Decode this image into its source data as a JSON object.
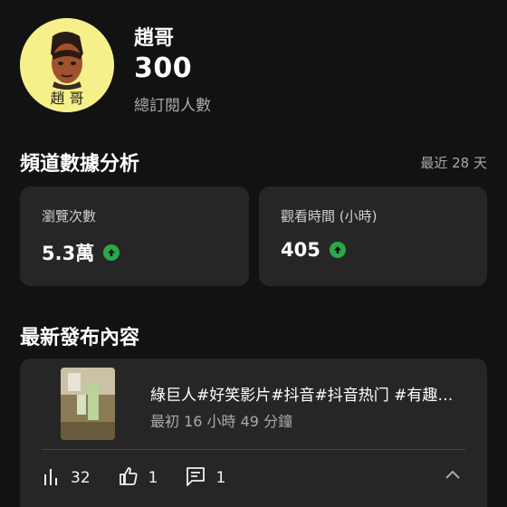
{
  "channel": {
    "avatar_caption": "趙 哥",
    "name": "趙哥",
    "subscriber_count": "300",
    "subscriber_label": "總訂閱人數"
  },
  "analytics": {
    "title": "頻道數據分析",
    "range": "最近 28 天",
    "stats": [
      {
        "label": "瀏覽次數",
        "value": "5.3萬",
        "trend_icon": "arrow-up-circle-icon"
      },
      {
        "label": "觀看時間 (小時)",
        "value": "405",
        "trend_icon": "arrow-up-circle-icon"
      }
    ],
    "trend_color": "#2ba84a"
  },
  "latest": {
    "title": "最新發布內容",
    "video": {
      "title": "綠巨人#好笑影片#抖音#抖音热门 #有趣#有趣影片",
      "time": "最初 16 小時 49 分鐘",
      "views": "32",
      "likes": "1",
      "comments": "1"
    }
  }
}
